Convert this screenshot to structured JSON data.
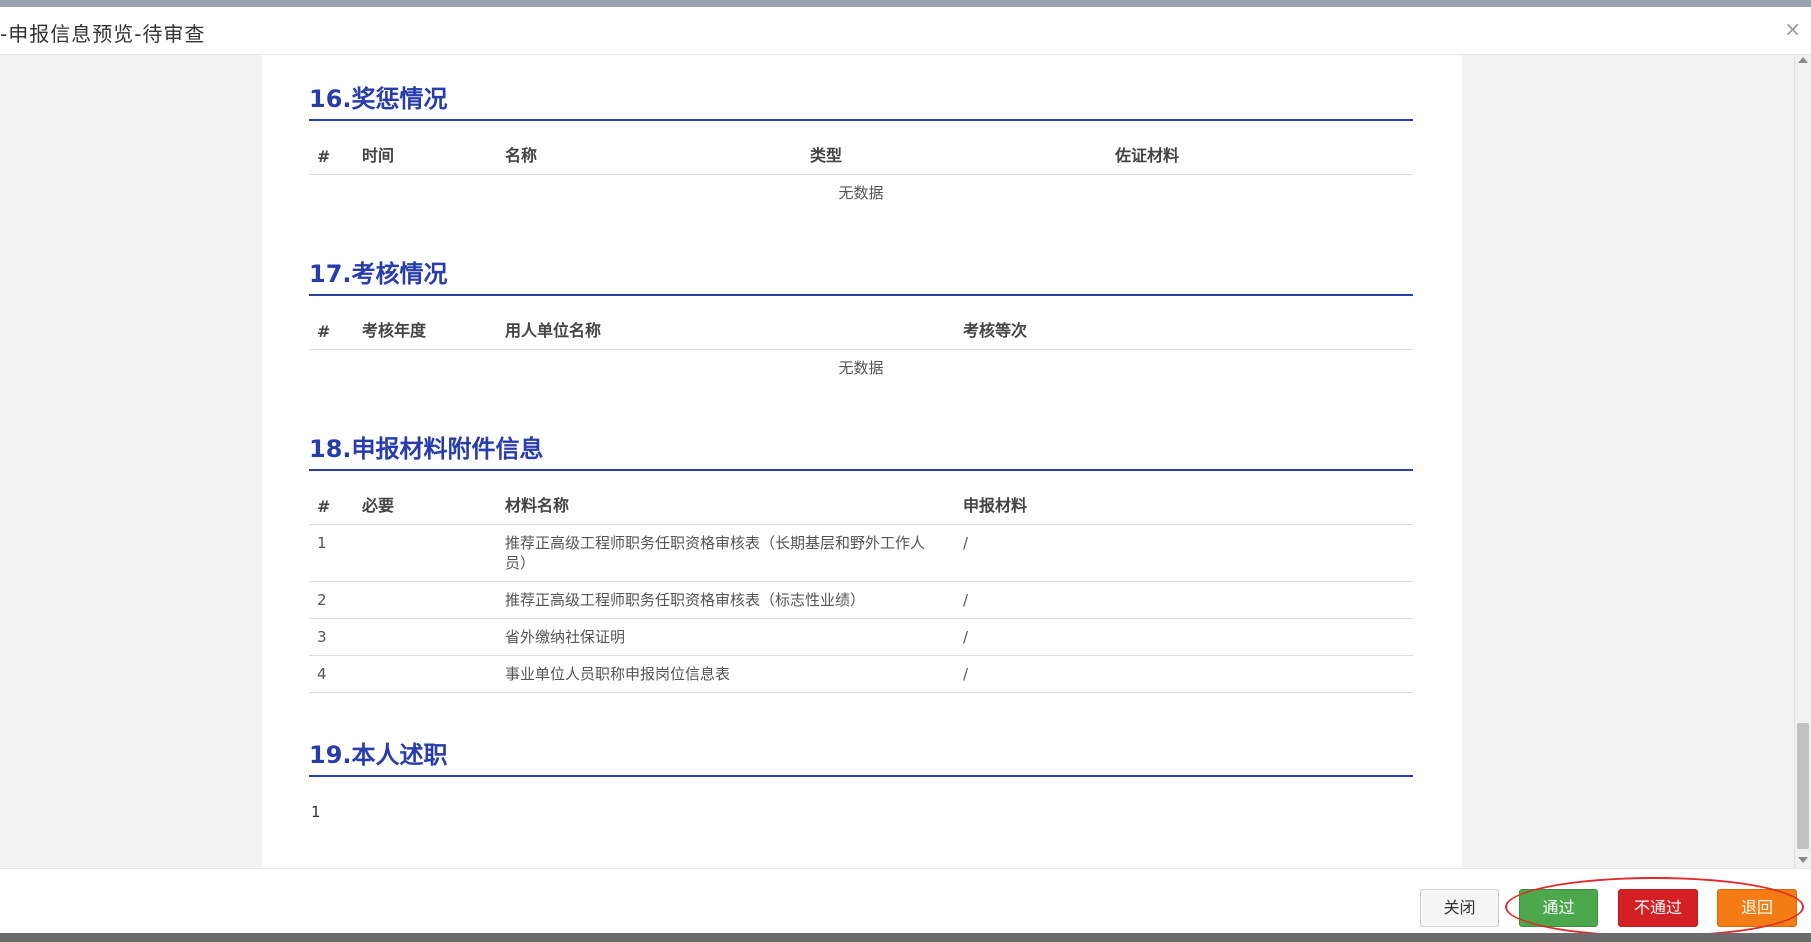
{
  "dialog": {
    "title": "-申报信息预览-待审查",
    "close_glyph": "×"
  },
  "sections": {
    "rewards": {
      "title": "16.奖惩情况",
      "headers": [
        "#",
        "时间",
        "名称",
        "类型",
        "佐证材料"
      ],
      "empty_text": "无数据"
    },
    "assessment": {
      "title": "17.考核情况",
      "headers": [
        "#",
        "考核年度",
        "用人单位名称",
        "考核等次"
      ],
      "empty_text": "无数据"
    },
    "attachments": {
      "title": "18.申报材料附件信息",
      "headers": [
        "#",
        "必要",
        "材料名称",
        "申报材料"
      ],
      "rows": [
        {
          "index": "1",
          "required": "",
          "name": "推荐正高级工程师职务任职资格审核表（长期基层和野外工作人员）",
          "material": "/"
        },
        {
          "index": "2",
          "required": "",
          "name": "推荐正高级工程师职务任职资格审核表（标志性业绩）",
          "material": "/"
        },
        {
          "index": "3",
          "required": "",
          "name": "省外缴纳社保证明",
          "material": "/"
        },
        {
          "index": "4",
          "required": "",
          "name": "事业单位人员职称申报岗位信息表",
          "material": "/"
        }
      ]
    },
    "self_statement": {
      "title": "19.本人述职",
      "text": "1"
    }
  },
  "footer": {
    "close_label": "关闭",
    "pass_label": "通过",
    "fail_label": "不通过",
    "return_label": "退回"
  }
}
